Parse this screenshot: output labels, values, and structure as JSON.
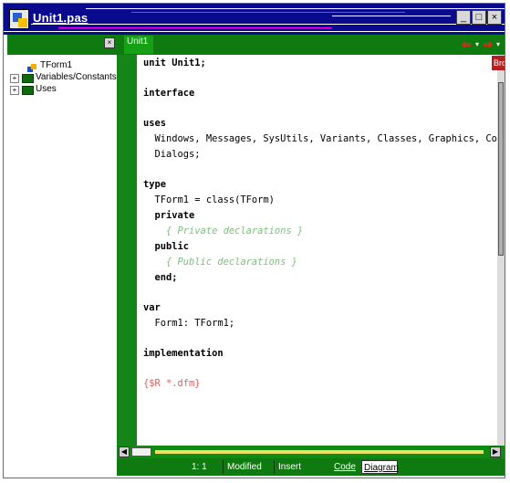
{
  "window": {
    "title": "Unit1.pas"
  },
  "tree": {
    "items": [
      {
        "label": "TForm1"
      },
      {
        "label": "Variables/Constants"
      },
      {
        "label": "Uses"
      }
    ]
  },
  "editor": {
    "tab_label": "Unit1",
    "browse_label": "Brows",
    "lines": [
      "unit Unit1;",
      "",
      "interface",
      "",
      "uses",
      "  Windows, Messages, SysUtils, Variants, Classes, Graphics, Co",
      "  Dialogs;",
      "",
      "type",
      "  TForm1 = class(TForm)",
      "  private",
      "    { Private declarations }",
      "  public",
      "    { Public declarations }",
      "  end;",
      "",
      "var",
      "  Form1: TForm1;",
      "",
      "implementation",
      "",
      "{$R *.dfm}"
    ]
  },
  "status": {
    "position": "1:  1",
    "modified": "Modified",
    "insert": "Insert",
    "code_tab": "Code",
    "diagram_tab": "Diagram"
  },
  "colors": {
    "titlebar": "#0a0a8e",
    "editor_chrome": "#0f7a10",
    "comment": "#7fbf7f",
    "directive": "#e06060"
  },
  "icons": [
    "app-icon",
    "form-icon",
    "folder-icon",
    "close-icon",
    "minimize-icon",
    "maximize-icon",
    "back-arrow-icon",
    "forward-arrow-icon"
  ]
}
